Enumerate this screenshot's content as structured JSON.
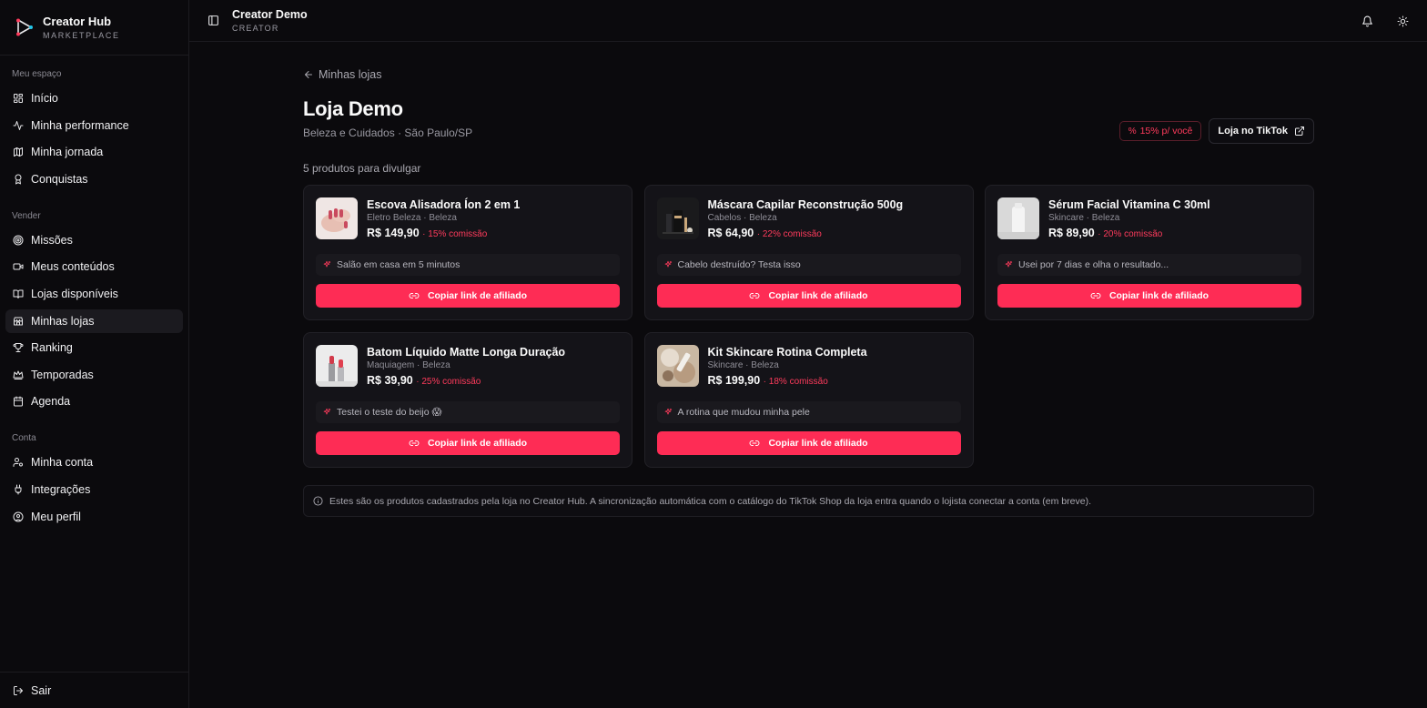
{
  "brand": {
    "name": "Creator Hub",
    "tagline": "MARKETPLACE"
  },
  "sidebar": {
    "sections": [
      {
        "heading": "Meu espaço",
        "items": [
          {
            "label": "Início",
            "icon": "dashboard-icon"
          },
          {
            "label": "Minha performance",
            "icon": "activity-icon"
          },
          {
            "label": "Minha jornada",
            "icon": "map-icon"
          },
          {
            "label": "Conquistas",
            "icon": "award-icon"
          }
        ]
      },
      {
        "heading": "Vender",
        "items": [
          {
            "label": "Missões",
            "icon": "target-icon"
          },
          {
            "label": "Meus conteúdos",
            "icon": "video-icon"
          },
          {
            "label": "Lojas disponíveis",
            "icon": "book-open-icon"
          },
          {
            "label": "Minhas lojas",
            "icon": "store-icon",
            "active": true
          },
          {
            "label": "Ranking",
            "icon": "trophy-icon"
          },
          {
            "label": "Temporadas",
            "icon": "crown-icon"
          },
          {
            "label": "Agenda",
            "icon": "calendar-icon"
          }
        ]
      },
      {
        "heading": "Conta",
        "items": [
          {
            "label": "Minha conta",
            "icon": "user-cog-icon"
          },
          {
            "label": "Integrações",
            "icon": "plug-icon"
          },
          {
            "label": "Meu perfil",
            "icon": "user-circle-icon"
          }
        ]
      }
    ],
    "logout_label": "Sair"
  },
  "topbar": {
    "title": "Creator Demo",
    "subtitle": "CREATOR"
  },
  "store": {
    "back_label": "Minhas lojas",
    "name": "Loja Demo",
    "subtitle": "Beleza e Cuidados · São Paulo/SP",
    "commission_badge": "15% p/ você",
    "tiktok_button": "Loja no TikTok",
    "products_count_label": "5 produtos para divulgar"
  },
  "products": [
    {
      "name": "Escova Alisadora Íon 2 em 1",
      "category": "Eletro Beleza · Beleza",
      "price": "R$ 149,90",
      "commission": "· 15% comissão",
      "hook": "Salão em casa em 5 minutos",
      "cta": "Copiar link de afiliado",
      "thumb": "hands-nails"
    },
    {
      "name": "Máscara Capilar Reconstrução 500g",
      "category": "Cabelos · Beleza",
      "price": "R$ 64,90",
      "commission": "· 22% comissão",
      "hook": "Cabelo destruído? Testa isso",
      "cta": "Copiar link de afiliado",
      "thumb": "makeup-dark"
    },
    {
      "name": "Sérum Facial Vitamina C 30ml",
      "category": "Skincare · Beleza",
      "price": "R$ 89,90",
      "commission": "· 20% comissão",
      "hook": "Usei por 7 dias e olha o resultado...",
      "cta": "Copiar link de afiliado",
      "thumb": "white-bottle"
    },
    {
      "name": "Batom Líquido Matte Longa Duração",
      "category": "Maquiagem · Beleza",
      "price": "R$ 39,90",
      "commission": "· 25% comissão",
      "hook": "Testei o teste do beijo 😱",
      "cta": "Copiar link de afiliado",
      "thumb": "lipsticks"
    },
    {
      "name": "Kit Skincare Rotina Completa",
      "category": "Skincare · Beleza",
      "price": "R$ 199,90",
      "commission": "· 18% comissão",
      "hook": "A rotina que mudou minha pele",
      "cta": "Copiar link de afiliado",
      "thumb": "flatlay"
    }
  ],
  "info_note": "Estes são os produtos cadastrados pela loja no Creator Hub. A sincronização automática com o catálogo do TikTok Shop da loja entra quando o lojista conectar a conta (em breve).",
  "colors": {
    "accent": "#fe2c55",
    "background": "#0b0a0d",
    "card": "#141318"
  }
}
